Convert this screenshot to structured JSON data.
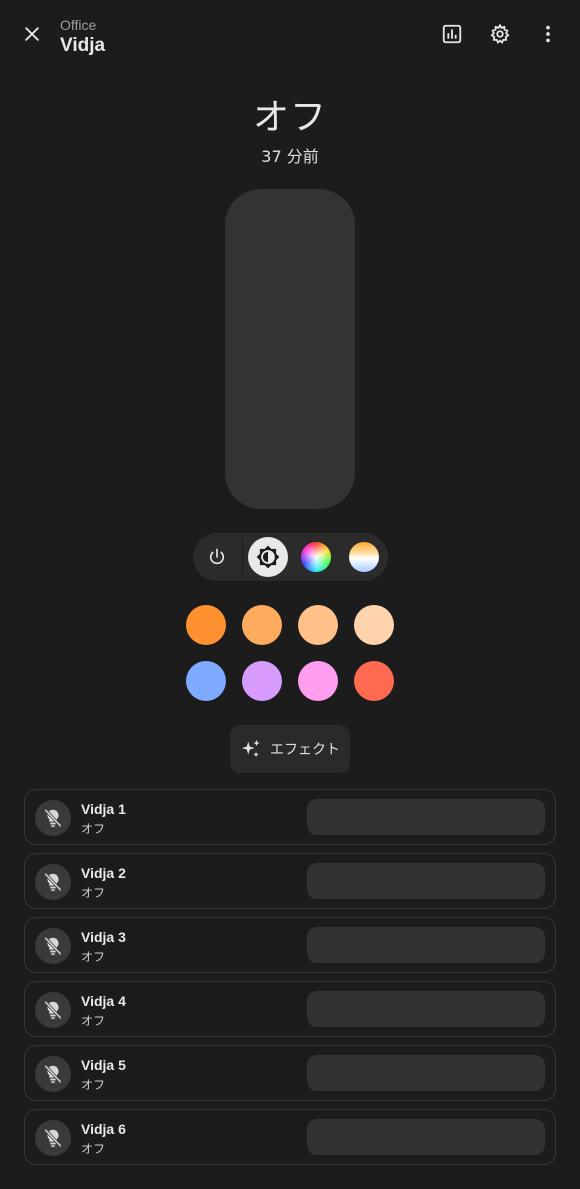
{
  "header": {
    "area": "Office",
    "title": "Vidja",
    "icons": [
      "close-icon",
      "history-chart-icon",
      "gear-icon",
      "more-vert-icon"
    ]
  },
  "state": {
    "label": "オフ",
    "last_changed": "37 分前",
    "brightness": 0
  },
  "modes": [
    {
      "name": "power-icon",
      "selected": false
    },
    {
      "name": "brightness-icon",
      "selected": true
    },
    {
      "name": "color-wheel-icon",
      "selected": false
    },
    {
      "name": "color-temp-icon",
      "selected": false
    }
  ],
  "presets": [
    {
      "color": "#ff9130"
    },
    {
      "color": "#ffab5e"
    },
    {
      "color": "#ffc08a"
    },
    {
      "color": "#ffd4ac"
    },
    {
      "color": "#7fabff"
    },
    {
      "color": "#d89cff"
    },
    {
      "color": "#ff9eef"
    },
    {
      "color": "#ff6a50"
    }
  ],
  "effects": {
    "label": "エフェクト"
  },
  "members": [
    {
      "name": "Vidja 1",
      "state": "オフ"
    },
    {
      "name": "Vidja 2",
      "state": "オフ"
    },
    {
      "name": "Vidja 3",
      "state": "オフ"
    },
    {
      "name": "Vidja 4",
      "state": "オフ"
    },
    {
      "name": "Vidja 5",
      "state": "オフ"
    },
    {
      "name": "Vidja 6",
      "state": "オフ"
    }
  ]
}
